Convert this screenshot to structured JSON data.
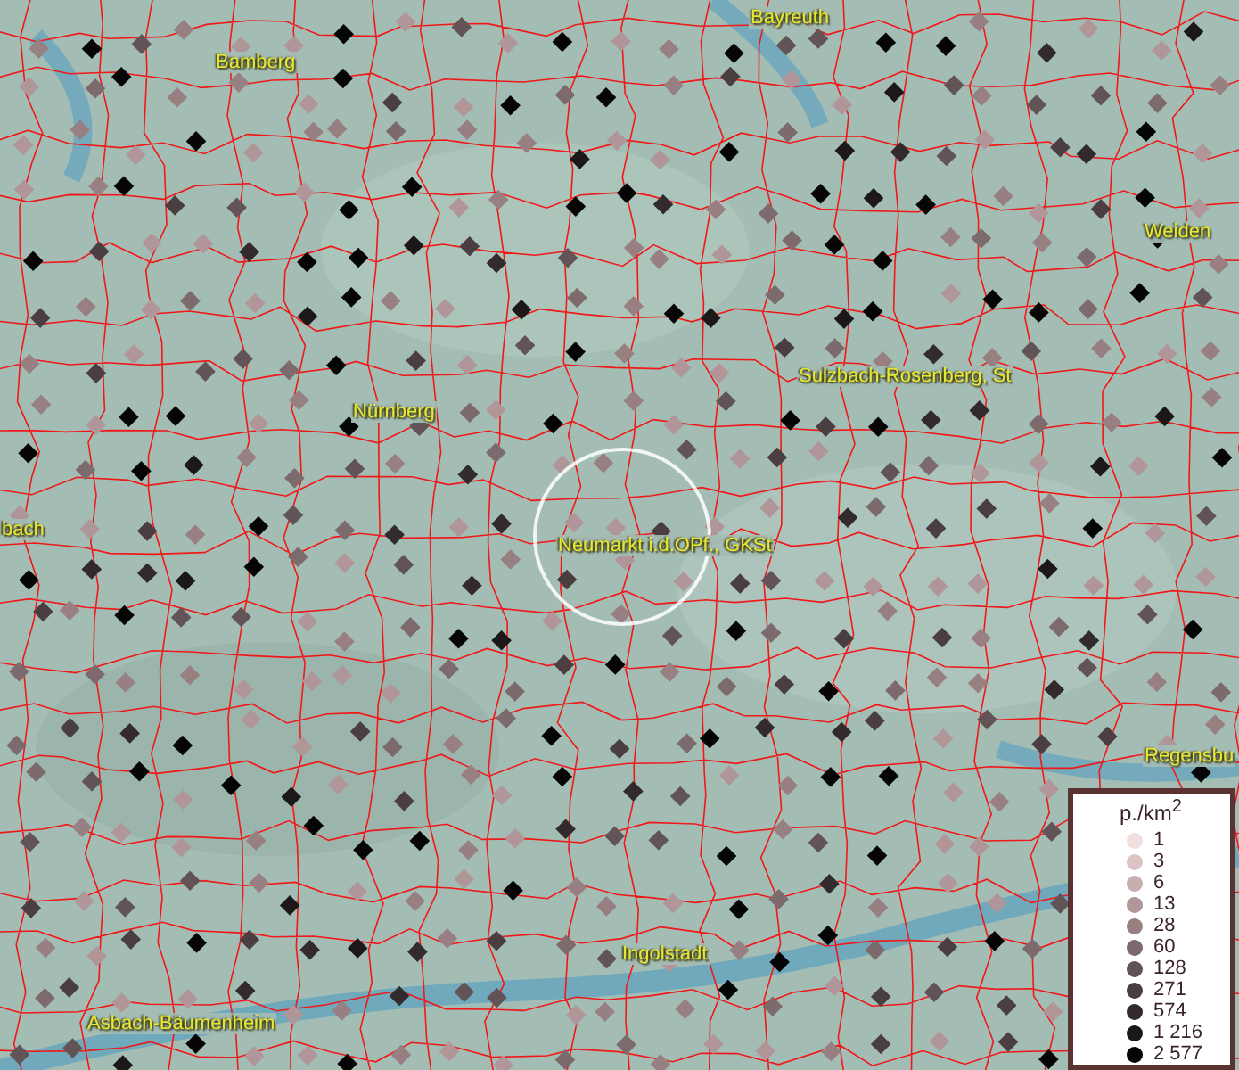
{
  "map": {
    "places": [
      {
        "label": "Bayreuth",
        "kind": "city"
      },
      {
        "label": "Bamberg",
        "kind": "city"
      },
      {
        "label": "Weiden",
        "kind": "city"
      },
      {
        "label": "Nürnberg",
        "kind": "city"
      },
      {
        "label": "Sulzbach-Rosenberg, St",
        "kind": "city"
      },
      {
        "label": "bach",
        "kind": "city"
      },
      {
        "label": "Neumarkt i.d.OPf., GKSt",
        "kind": "highlighted"
      },
      {
        "label": "Regensbu",
        "kind": "city"
      },
      {
        "label": "Ingolstadt",
        "kind": "city"
      },
      {
        "label": "Asbach-Bäumenheim",
        "kind": "city"
      }
    ]
  },
  "legend": {
    "title": "p./km$^{2}$",
    "items": [
      {
        "label": "1",
        "color": "#f2dfe0"
      },
      {
        "label": "3",
        "color": "#dcc4c6"
      },
      {
        "label": "6",
        "color": "#c8aeb0"
      },
      {
        "label": "13",
        "color": "#b09698"
      },
      {
        "label": "28",
        "color": "#988082"
      },
      {
        "label": "60",
        "color": "#7c6a6c"
      },
      {
        "label": "128",
        "color": "#625456"
      },
      {
        "label": "271",
        "color": "#4a3e40"
      },
      {
        "label": "574",
        "color": "#322a2c"
      },
      {
        "label": "1 216",
        "color": "#1c1819"
      },
      {
        "label": "2 577",
        "color": "#060505"
      }
    ]
  }
}
